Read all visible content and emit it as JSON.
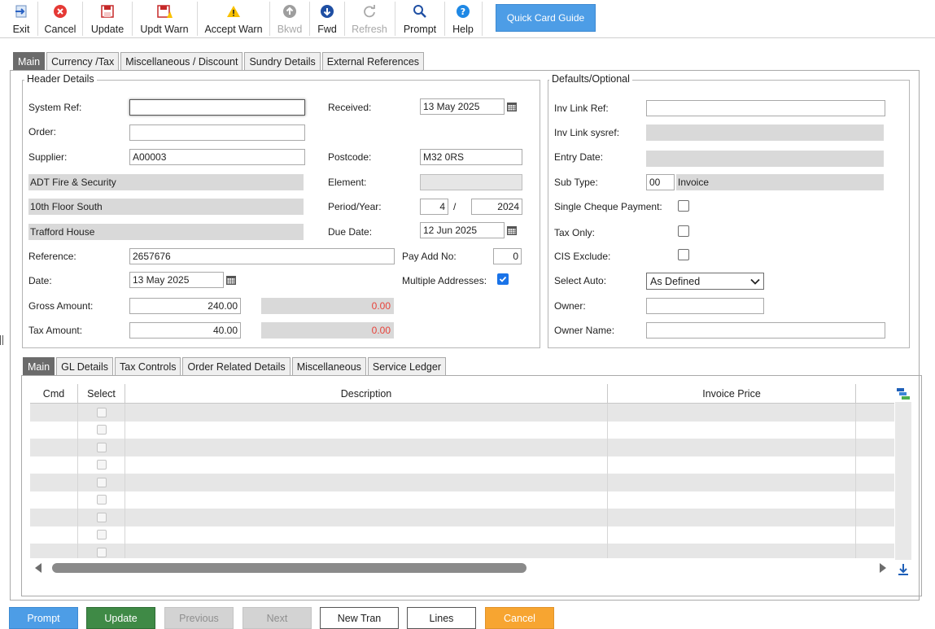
{
  "toolbar": {
    "exit": "Exit",
    "cancel": "Cancel",
    "update": "Update",
    "updt_warn": "Updt Warn",
    "accept_warn": "Accept Warn",
    "bkwd": "Bkwd",
    "fwd": "Fwd",
    "refresh": "Refresh",
    "prompt": "Prompt",
    "help": "Help",
    "quick_card_guide": "Quick Card Guide"
  },
  "top_tabs": [
    "Main",
    "Currency /Tax",
    "Miscellaneous / Discount",
    "Sundry Details",
    "External References"
  ],
  "header": {
    "title": "Header Details",
    "system_ref_label": "System Ref:",
    "system_ref_value": "",
    "order_label": "Order:",
    "order_value": "",
    "supplier_label": "Supplier:",
    "supplier_value": "A00003",
    "supplier_name": "ADT Fire & Security",
    "address1": "10th Floor South",
    "address2": "Trafford House",
    "reference_label": "Reference:",
    "reference_value": "2657676",
    "date_label": "Date:",
    "date_value": "13 May 2025",
    "gross_label": "Gross Amount:",
    "gross_value": "240.00",
    "gross_diff": "0.00",
    "tax_label": "Tax Amount:",
    "tax_value": "40.00",
    "tax_diff": "0.00",
    "received_label": "Received:",
    "received_value": "13 May 2025",
    "postcode_label": "Postcode:",
    "postcode_value": "M32 0RS",
    "element_label": "Element:",
    "element_value": "",
    "period_label": "Period/Year:",
    "period_value": "4",
    "period_sep": "/",
    "year_value": "2024",
    "due_label": "Due Date:",
    "due_value": "12 Jun 2025",
    "pay_add_label": "Pay Add No:",
    "pay_add_value": "0",
    "multi_addr_label": "Multiple Addresses:",
    "multi_addr_checked": true
  },
  "defaults": {
    "title": "Defaults/Optional",
    "inv_link_ref_label": "Inv Link Ref:",
    "inv_link_ref_value": "",
    "inv_link_sysref_label": "Inv Link sysref:",
    "inv_link_sysref_value": "",
    "entry_date_label": "Entry Date:",
    "entry_date_value": "",
    "sub_type_label": "Sub Type:",
    "sub_type_code": "00",
    "sub_type_name": "Invoice",
    "single_cheque_label": "Single Cheque Payment:",
    "tax_only_label": "Tax Only:",
    "cis_exclude_label": "CIS Exclude:",
    "select_auto_label": "Select Auto:",
    "select_auto_value": "As Defined",
    "owner_label": "Owner:",
    "owner_value": "",
    "owner_name_label": "Owner Name:",
    "owner_name_value": ""
  },
  "lower_tabs": [
    "Main",
    "GL Details",
    "Tax Controls",
    "Order Related Details",
    "Miscellaneous",
    "Service Ledger"
  ],
  "grid": {
    "columns": [
      "Cmd",
      "Select",
      "Description",
      "Invoice Price"
    ],
    "row_count": 9
  },
  "bottom_buttons": {
    "prompt": "Prompt",
    "update": "Update",
    "previous": "Previous",
    "next": "Next",
    "new_tran": "New Tran",
    "lines": "Lines",
    "cancel": "Cancel"
  },
  "colors": {
    "accent_blue": "#4d9de6",
    "update_green": "#3f8a46",
    "cancel_orange": "#f7a531",
    "diff_red": "#e8423a",
    "readonly_grey": "#d9d9d9"
  }
}
